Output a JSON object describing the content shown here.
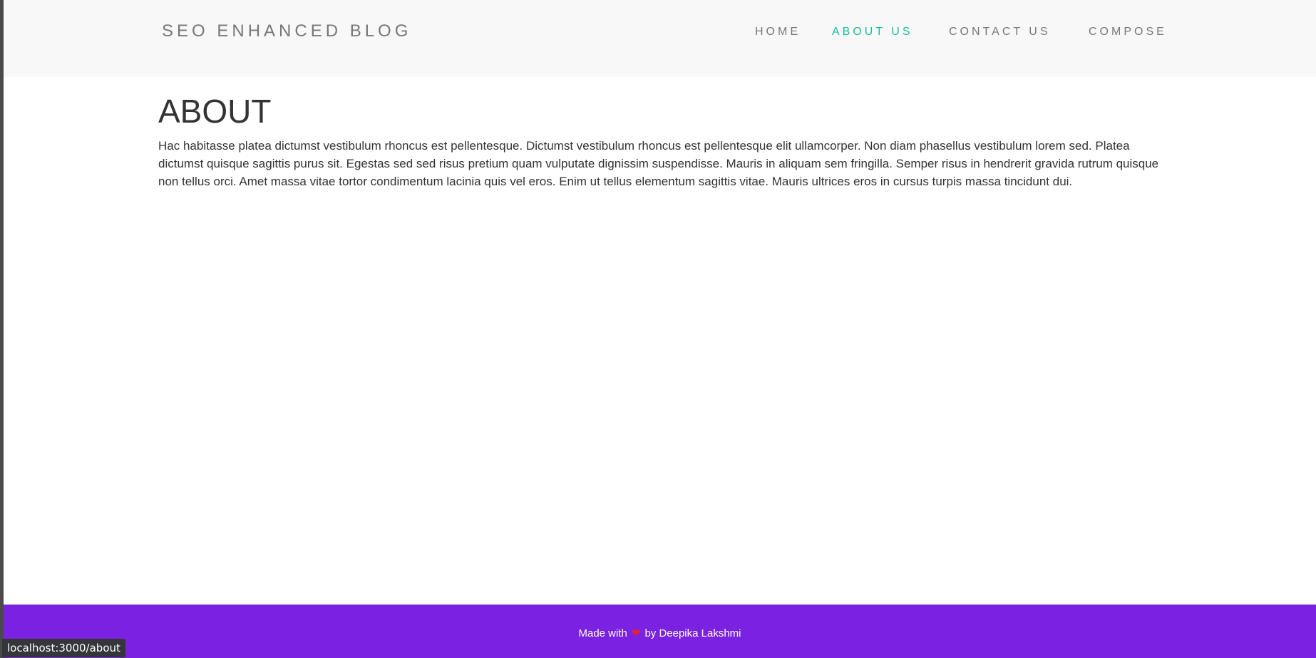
{
  "navbar": {
    "brand": "SEO ENHANCED BLOG",
    "links": [
      {
        "label": "HOME",
        "active": false
      },
      {
        "label": "ABOUT US",
        "active": true
      },
      {
        "label": "CONTACT US",
        "active": false
      },
      {
        "label": "COMPOSE",
        "active": false
      }
    ],
    "active_color": "#1abc9c",
    "link_color": "#777777"
  },
  "main": {
    "title": "ABOUT",
    "body": "Hac habitasse platea dictumst vestibulum rhoncus est pellentesque. Dictumst vestibulum rhoncus est pellentesque elit ullamcorper. Non diam phasellus vestibulum lorem sed. Platea dictumst quisque sagittis purus sit. Egestas sed sed risus pretium quam vulputate dignissim suspendisse. Mauris in aliquam sem fringilla. Semper risus in hendrerit gravida rutrum quisque non tellus orci. Amet massa vitae tortor condimentum lacinia quis vel eros. Enim ut tellus elementum sagittis vitae. Mauris ultrices eros in cursus turpis massa tincidunt dui."
  },
  "footer": {
    "made_with": "Made with",
    "heart_icon": "heart-icon",
    "by_author": "by Deepika Lakshmi",
    "background_color": "#7b22e2"
  },
  "status_bar": {
    "url": "localhost:3000/about"
  }
}
